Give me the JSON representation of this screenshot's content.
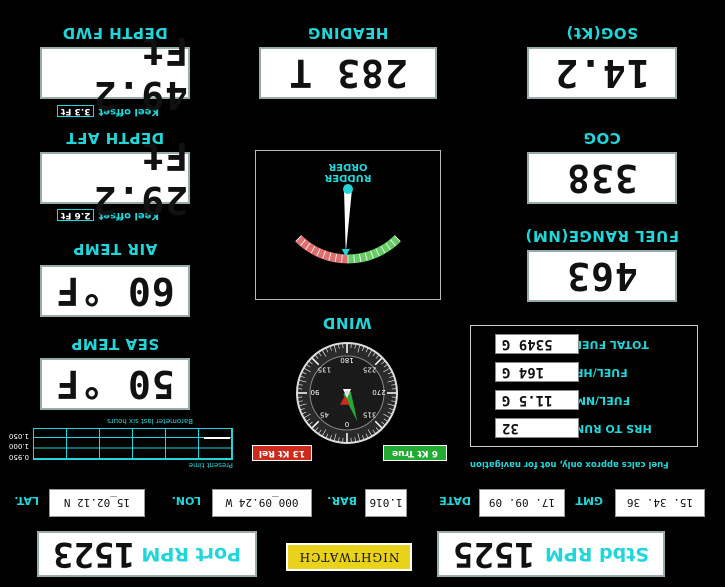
{
  "engines": {
    "port_label": "Port RPM",
    "port_value": "1523",
    "stbd_label": "Stbd RPM",
    "stbd_value": "1525",
    "logo": "NIGHTWATCH"
  },
  "position": {
    "lat_label": "LAT.",
    "lat_value": "15_02.12 N",
    "lon_label": "LON.",
    "lon_value": "000_09.24 W",
    "bar_label": "BAR.",
    "bar_value": "1.016",
    "date_label": "DATE",
    "date_value": "17. 09. 09",
    "gmt_label": "GMT",
    "gmt_value": "15. 34. 36"
  },
  "barometer": {
    "title": "Present time",
    "footer": "Barometer last six hours",
    "scale": [
      "0.950",
      "1.000",
      "1.050"
    ],
    "reading": 1.016
  },
  "sea_temp": {
    "label": "SEA TEMP",
    "value": "50 °F"
  },
  "air_temp": {
    "label": "AIR TEMP",
    "value": "60 °F"
  },
  "depth_aft": {
    "label": "DEPTH AFT",
    "value": "29.2 Ft",
    "keel_label": "Keel offset",
    "keel_value": "2.6 Ft"
  },
  "depth_fwd": {
    "label": "DEPTH FWD",
    "value": "49.2 Ft",
    "keel_label": "Keel offset",
    "keel_value": "3.3 Ft"
  },
  "wind": {
    "label": "WIND",
    "true_badge": "6 Kt True",
    "rel_badge": "13 Kt Rel",
    "ticks": [
      "0",
      "45",
      "90",
      "135",
      "180",
      "225",
      "270",
      "315"
    ],
    "true_angle": 340,
    "rel_angle": 15,
    "colors": {
      "true": "#22aa33",
      "rel": "#cc2a1a"
    }
  },
  "rudder": {
    "label_line1": "RUDDER",
    "label_line2": "ORDER",
    "angle": 2
  },
  "heading": {
    "label": "HEADING",
    "value": "283 T"
  },
  "fuel": {
    "note": "Fuel calcs approx only, not for navigation",
    "total_label": "TOTAL FUEL",
    "total_value": "5349 G",
    "hr_label": "FUEL/HR",
    "hr_value": "164 G",
    "nm_label": "FUEL/NM",
    "nm_value": "11.5 G",
    "hrs_label": "HRS TO RUN",
    "hrs_value": "32"
  },
  "fuel_range": {
    "label": "FUEL RANGE(NM)",
    "value": "463"
  },
  "cog": {
    "label": "COG",
    "value": "338"
  },
  "sog": {
    "label": "SOG(Kt)",
    "value": "14.2"
  }
}
